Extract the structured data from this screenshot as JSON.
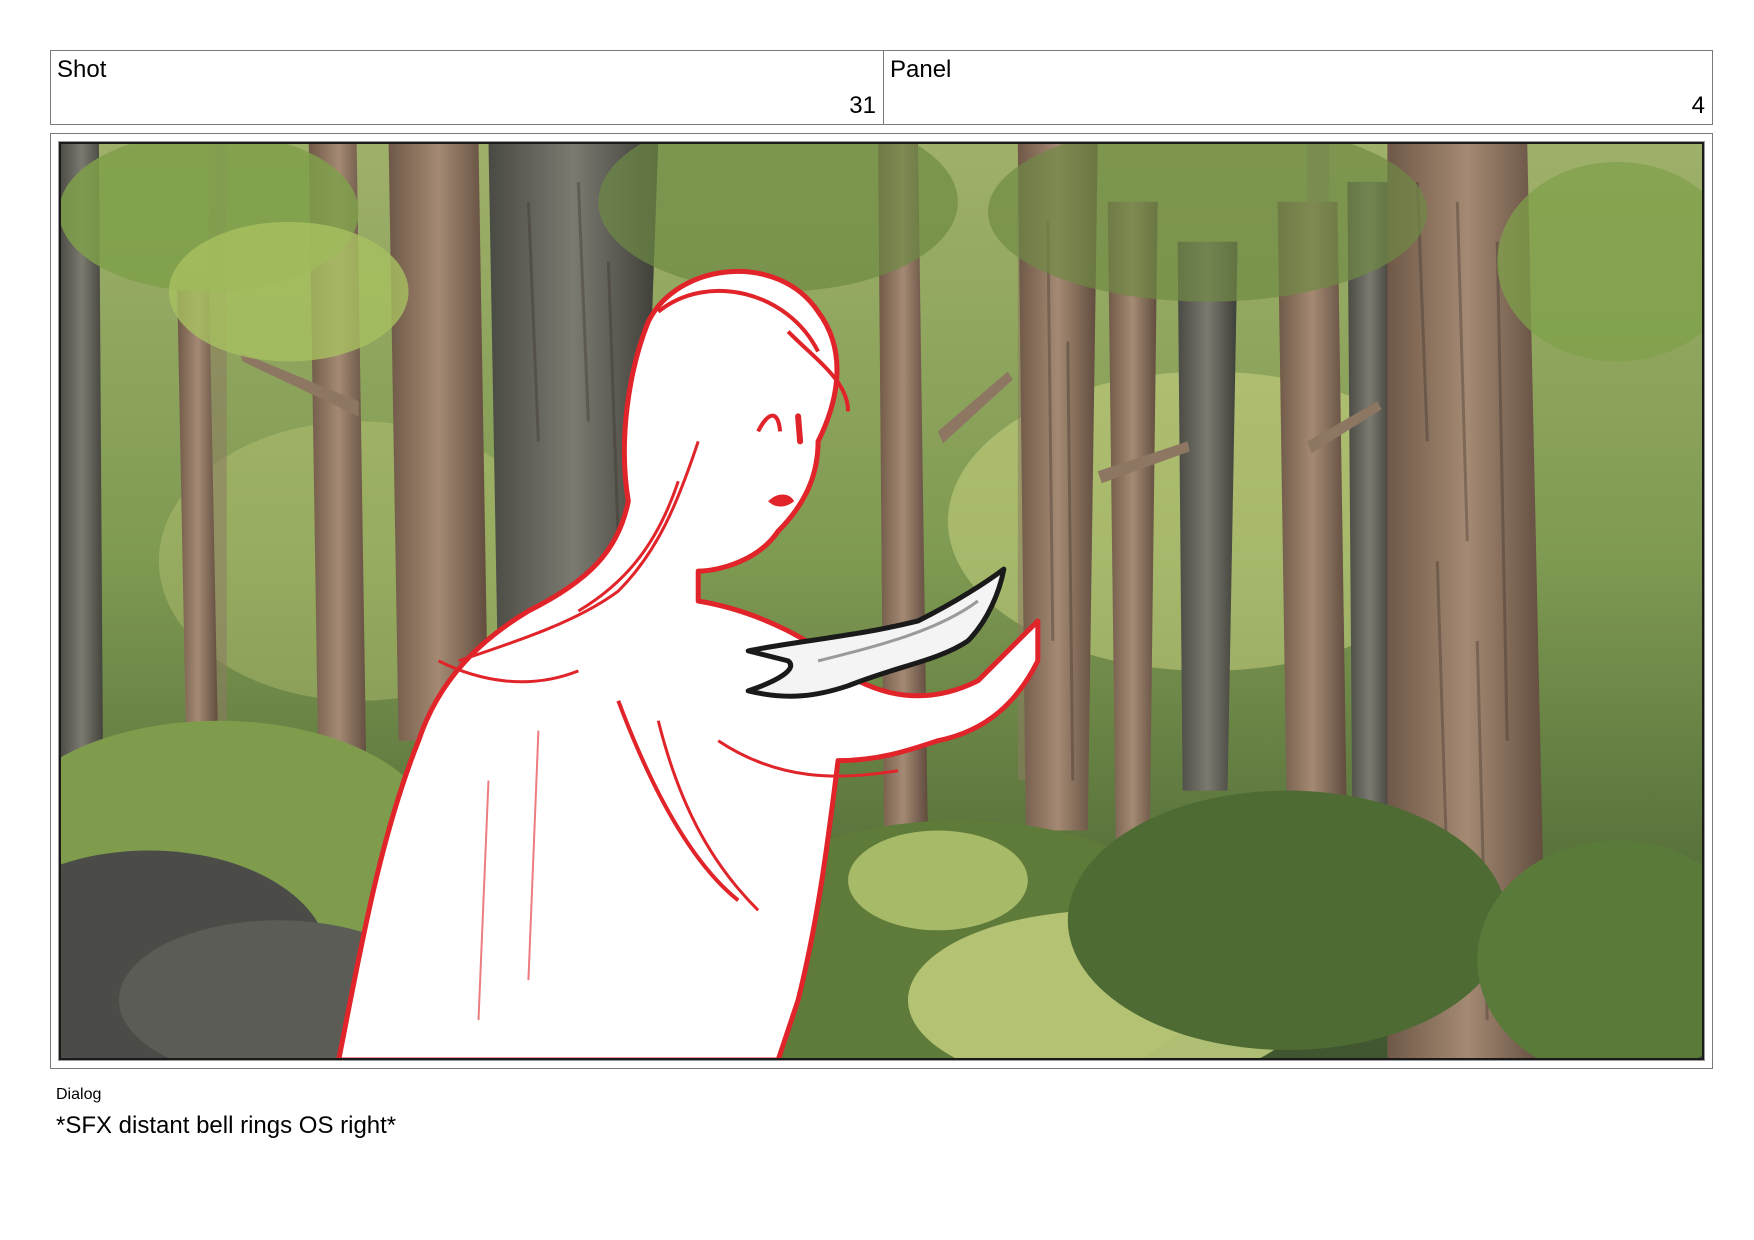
{
  "header": {
    "shot_label": "Shot",
    "shot_value": "31",
    "panel_label": "Panel",
    "panel_value": "4"
  },
  "panel_image": {
    "subject": "storyboard-sketch-figure-in-forest",
    "colors": {
      "sketch_line": "#e0242a",
      "figure_fill": "#ffffff",
      "held_object_outline": "#1a1a1a",
      "foliage_dark": "#4f6b2e",
      "foliage_light": "#a9c46a",
      "bark": "#8a6f5a"
    }
  },
  "dialog": {
    "label": "Dialog",
    "text": "*SFX distant bell rings OS right*"
  }
}
